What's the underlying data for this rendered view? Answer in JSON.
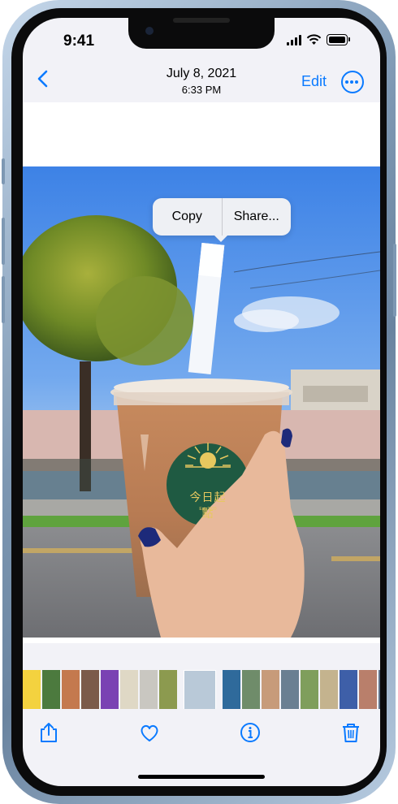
{
  "status": {
    "time": "9:41"
  },
  "header": {
    "date": "July 8, 2021",
    "time": "6:33 PM",
    "edit_label": "Edit"
  },
  "icons": {
    "back": "chevron-left-icon",
    "more": "ellipsis-circle-icon",
    "share": "share-icon",
    "favorite": "heart-icon",
    "info": "info-circle-icon",
    "delete": "trash-icon"
  },
  "context_menu": {
    "copy_label": "Copy",
    "share_label": "Share..."
  },
  "sticker": {
    "text": "今日起點",
    "est": "Est. 2020"
  },
  "colors": {
    "accent": "#0a7aff",
    "sticker": "#1f5a42"
  }
}
